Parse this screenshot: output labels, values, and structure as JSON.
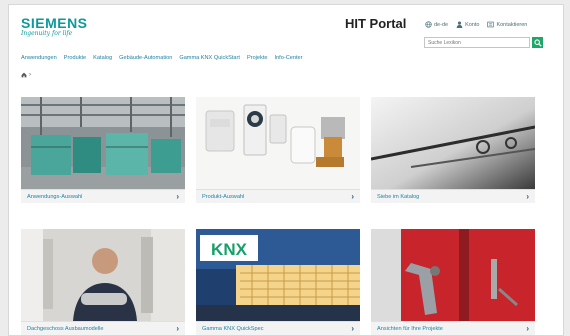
{
  "header": {
    "brand": "SIEMENS",
    "slogan": "Ingenuity for life",
    "portal_title": "HIT Portal",
    "language": "de-de",
    "account": "Konto",
    "contact": "Kontaktieren",
    "search_placeholder": "Suche Lexikon"
  },
  "nav": {
    "items": [
      "Anwendungen",
      "Produkte",
      "Katalog",
      "Gebäude-Automation",
      "Gamma KNX QuickStart",
      "Projekte",
      "Info-Center"
    ]
  },
  "breadcrumb": {
    "home_icon": "home-icon",
    "separator": "›"
  },
  "tiles": [
    {
      "label": "Anwendungs-Auswahl",
      "icon": "chevron-right-icon"
    },
    {
      "label": "Produkt-Auswahl",
      "icon": "chevron-right-icon"
    },
    {
      "label": "Siebe im Katalog",
      "icon": "chevron-right-icon"
    },
    {
      "label": "Dachgeschoss Ausbaumodelle",
      "icon": "chevron-right-icon"
    },
    {
      "label": "Gamma KNX QuickSpec",
      "icon": "chevron-right-icon"
    },
    {
      "label": "Ansichten für Ihre Projekte",
      "icon": "chevron-right-icon"
    }
  ],
  "knx_logo_text": "KNX",
  "colors": {
    "brand": "#0b9a9b",
    "link": "#1e83a5",
    "search_button": "#1fa66b"
  }
}
